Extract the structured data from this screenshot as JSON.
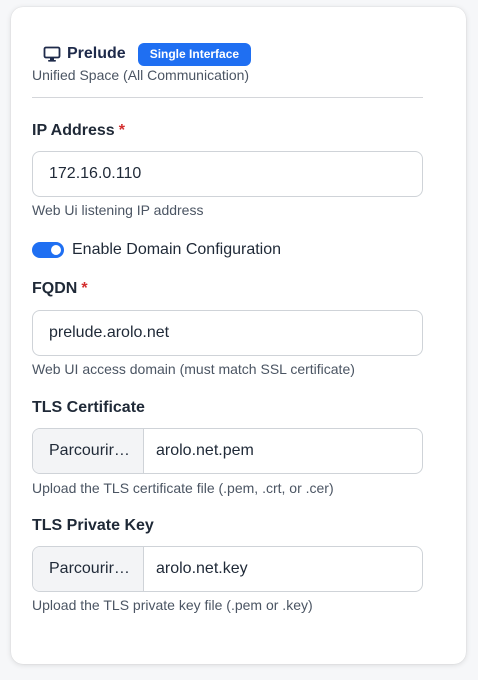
{
  "header": {
    "icon": "monitor-icon",
    "title": "Prelude",
    "badge": "Single Interface",
    "subtitle": "Unified Space (All Communication)"
  },
  "ip": {
    "label": "IP Address",
    "required_mark": "*",
    "value": "172.16.0.110",
    "help": "Web Ui listening IP address"
  },
  "domain_toggle": {
    "label": "Enable Domain Configuration",
    "enabled": true
  },
  "fqdn": {
    "label": "FQDN",
    "required_mark": "*",
    "value": "prelude.arolo.net",
    "help": "Web UI access domain (must match SSL certificate)"
  },
  "tls_cert": {
    "label": "TLS Certificate",
    "button": "Parcourir…",
    "file": "arolo.net.pem",
    "help": "Upload the TLS certificate file (.pem, .crt, or .cer)"
  },
  "tls_key": {
    "label": "TLS Private Key",
    "button": "Parcourir…",
    "file": "arolo.net.key",
    "help": "Upload the TLS private key file (.pem or .key)"
  },
  "colors": {
    "accent": "#1f6ff2",
    "required": "#d32f2f"
  }
}
